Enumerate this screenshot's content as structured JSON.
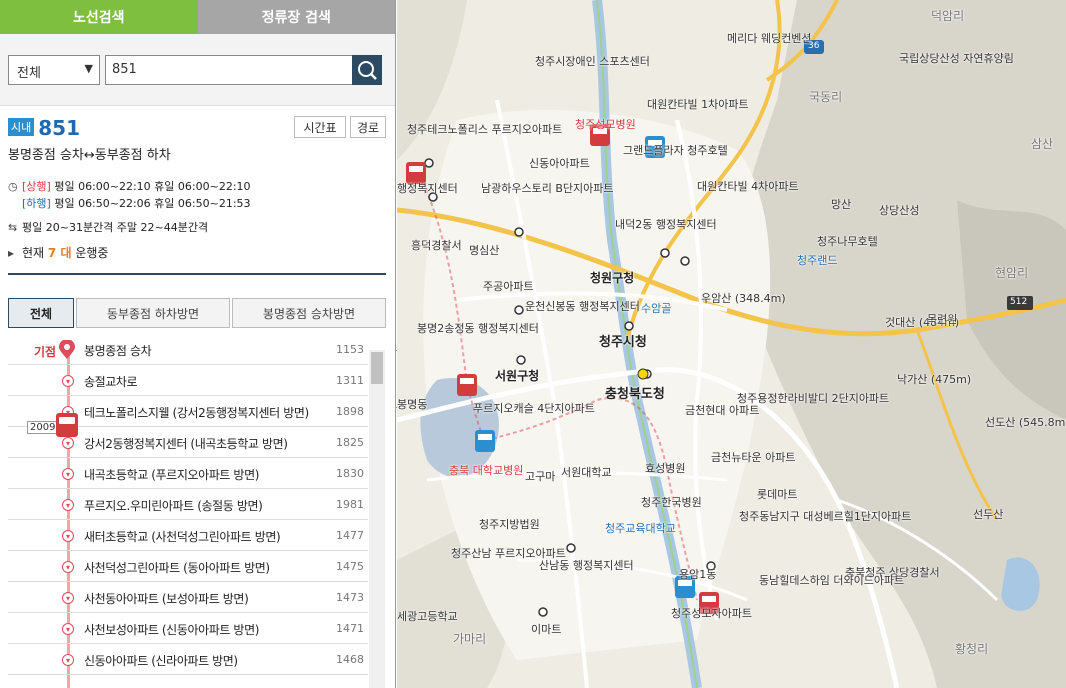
{
  "tabs": {
    "route_search": "노선검색",
    "stop_search": "정류장 검색"
  },
  "search": {
    "category": "전체",
    "query": "851"
  },
  "route": {
    "badge": "시내",
    "number": "851",
    "time_table_label": "시간표",
    "path_label": "경로",
    "description": "봉명종점 승차↔동부종점 하차",
    "up_label": "[상행]",
    "up_times": "평일 06:00~22:10 휴일 06:00~22:10",
    "down_label": "[하행]",
    "down_times": "평일 06:50~22:06 휴일 06:50~21:53",
    "interval": "평일 20~31분간격 주말 22~44분간격",
    "running_prefix": "현재",
    "running_count": "7 대",
    "running_suffix": "운행중"
  },
  "subtabs": [
    "전체",
    "동부종점 하차방면",
    "봉명종점 승차방면"
  ],
  "start_label": "기점",
  "bus_id": "2009",
  "stops": [
    {
      "name": "봉명종점 승차",
      "id": "1153"
    },
    {
      "name": "송절교차로",
      "id": "1311"
    },
    {
      "name": "테크노폴리스지웰 (강서2동행정복지센터 방면)",
      "id": "1898"
    },
    {
      "name": "강서2동행정복지센터 (내곡초등학교 방면)",
      "id": "1825"
    },
    {
      "name": "내곡초등학교 (푸르지오아파트 방면)",
      "id": "1830"
    },
    {
      "name": "푸르지오.우미린아파트 (송절동 방면)",
      "id": "1981"
    },
    {
      "name": "새터초등학교 (사천덕성그린아파트 방면)",
      "id": "1477"
    },
    {
      "name": "사천덕성그린아파트 (동아아파트 방면)",
      "id": "1475"
    },
    {
      "name": "사천동아아파트 (보성아파트 방면)",
      "id": "1473"
    },
    {
      "name": "사천보성아파트 (신동아아파트 방면)",
      "id": "1471"
    },
    {
      "name": "신동아아파트 (신라아파트 방면)",
      "id": "1468"
    }
  ],
  "map_labels": {
    "a": "청주시청",
    "b": "충청북도청",
    "c": "서원구청",
    "d": "청원구청",
    "e": "흥덕경찰서",
    "f": "청주교육대학교",
    "g": "서원대학교",
    "h": "우암산 (348.4m)",
    "i": "상당산성",
    "j": "국립상당산성 자연휴양림",
    "k": "청주나무호텔",
    "l": "충북청주 상당경찰서",
    "m": "것대산 (484m)",
    "n": "낙가산 (475m)",
    "o": "선도산 (545.8m)",
    "p": "선두산",
    "q": "메리다 웨딩컨벤션",
    "r": "청주시장애인 스포츠센터",
    "s": "대원칸타빌 1차아파트",
    "t": "대원칸타빌 4차아파트",
    "u": "내덕2동 행정복지센터",
    "v": "운천신봉동 행정복지센터",
    "w": "봉명2송정동 행정복지센터",
    "x": "주공아파트",
    "y": "푸르지오캐슬 4단지아파트",
    "z": "충북 대학교병원",
    "aa": "고구마",
    "ab": "효성병원",
    "ac": "금천뉴타운 아파트",
    "ad": "롯데마트",
    "ae": "청주한국병원",
    "af": "청주지방법원",
    "ag": "청주산남 푸르지오아파트",
    "ah": "산남동 행정복지센터",
    "ai": "동남힐데스하임 더와이드아파트",
    "aj": "청주동남지구 대성베르힐1단지아파트",
    "ak": "청주용정한라비발디 2단지아파트",
    "al": "덕암리",
    "am": "국동리",
    "an": "현암리",
    "ao": "황청리",
    "ap": "삼산",
    "aq": "목련원",
    "ar": "가마리",
    "as": "이마트",
    "at": "신동아아파트",
    "au": "남광하우스토리 B단지아파트",
    "av": "명심산",
    "aw": "수암골",
    "ax": "망산",
    "ay": "청주랜드",
    "az": "청주테크노폴리스 푸르지오아파트",
    "ba": "청주성모병원",
    "bb": "금천현대 아파트",
    "bc": "용암1동",
    "bd": "세광고등학교",
    "be": "512",
    "bf": "36",
    "bg": "그랜드플라자 청주호텔",
    "bh": "행정복지센터",
    "bi": "청주시청",
    "bj": "흥덕경찰서",
    "bk": "봉명동",
    "bl": "청주성모병원",
    "bm": "청주성모자아파트"
  }
}
